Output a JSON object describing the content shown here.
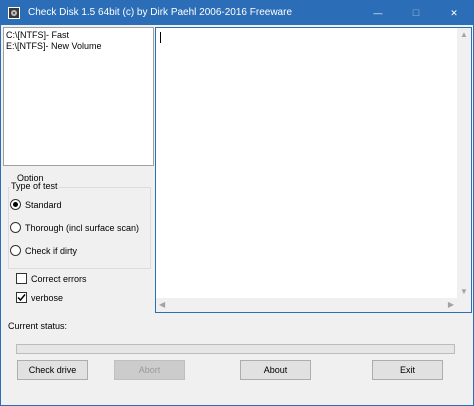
{
  "window": {
    "title": "Check Disk 1.5 64bit (c) by Dirk Paehl  2006-2016 Freeware",
    "minimize_glyph": "—",
    "maximize_glyph": "☐",
    "close_glyph": "✕"
  },
  "drives": [
    {
      "label": "C:\\[NTFS]- Fast"
    },
    {
      "label": "E:\\[NTFS]- New Volume"
    }
  ],
  "log": {
    "text": ""
  },
  "options": {
    "title": "Option",
    "type_of_test": "Type of test",
    "tests": [
      {
        "label": "Standard",
        "selected": true
      },
      {
        "label": "Thorough (incl surface scan)",
        "selected": false
      },
      {
        "label": "Check if dirty",
        "selected": false
      }
    ],
    "correct_errors": {
      "label": "Correct errors",
      "checked": false
    },
    "verbose": {
      "label": "verbose",
      "checked": true
    }
  },
  "status": {
    "label": "Current status:",
    "progress": 0
  },
  "buttons": {
    "check_drive": "Check drive",
    "abort": "Abort",
    "about": "About",
    "exit": "Exit"
  },
  "colors": {
    "titlebar": "#2b6db6",
    "progress_fill": "#06b025"
  }
}
